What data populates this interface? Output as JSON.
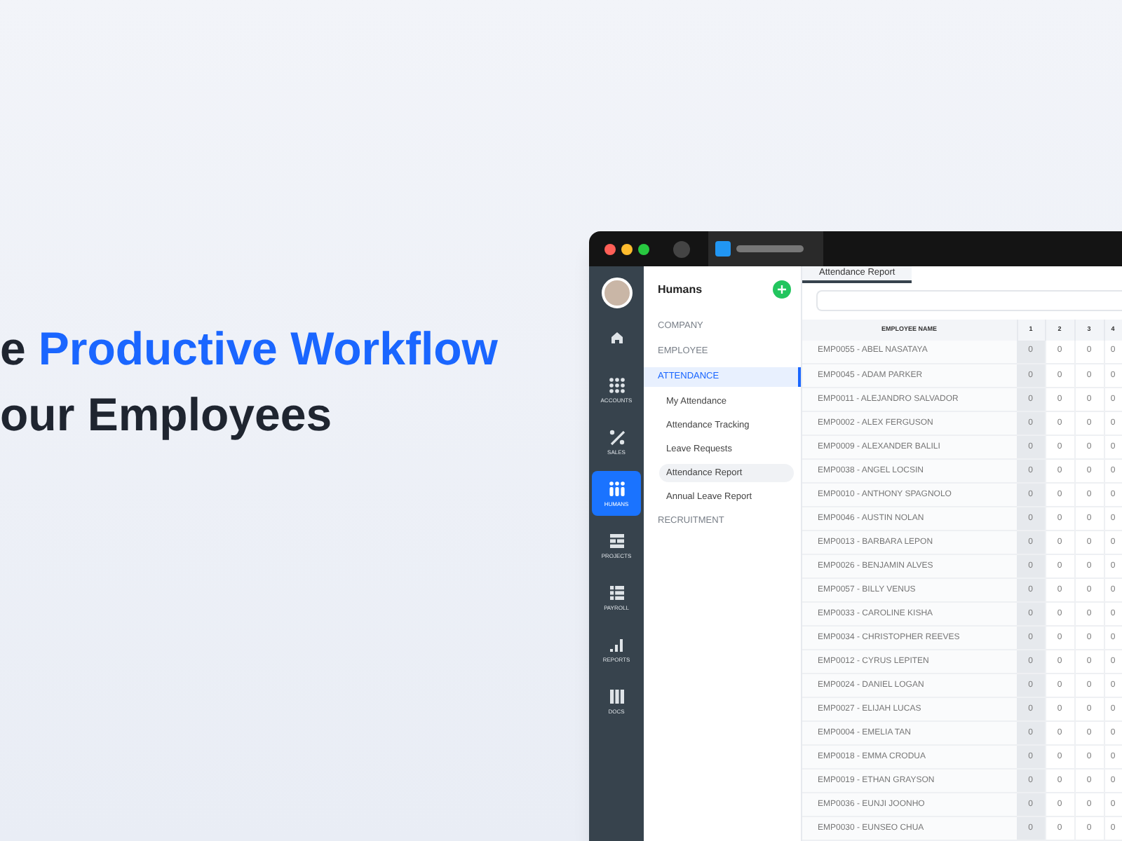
{
  "headline": {
    "lines": [
      [
        {
          "text": "e",
          "accent": false
        },
        {
          "text": "Productive Workflow",
          "accent": true
        }
      ],
      [
        {
          "text": "our Employees",
          "accent": false
        }
      ]
    ]
  },
  "app": {
    "rail": [
      {
        "kind": "avatar",
        "selected": false
      },
      {
        "kind": "home",
        "selected": false
      },
      {
        "kind": "grid",
        "label": "ACCOUNTS",
        "selected": false
      },
      {
        "kind": "percent",
        "label": "SALES",
        "selected": false
      },
      {
        "kind": "people",
        "label": "HUMANS",
        "selected": true
      },
      {
        "kind": "projects",
        "label": "PROJECTS",
        "selected": false
      },
      {
        "kind": "list",
        "label": "PAYROLL",
        "selected": false
      },
      {
        "kind": "bars",
        "label": "REPORTS",
        "selected": false
      },
      {
        "kind": "docs",
        "label": "DOCS",
        "selected": false
      }
    ],
    "module": {
      "title": "Humans",
      "menu": [
        {
          "label": "COMPANY",
          "selected": false
        },
        {
          "label": "EMPLOYEE",
          "selected": false
        },
        {
          "label": "ATTENDANCE",
          "selected": true,
          "children": [
            {
              "label": "My Attendance",
              "selected": false
            },
            {
              "label": "Attendance Tracking",
              "selected": false
            },
            {
              "label": "Leave Requests",
              "selected": false
            },
            {
              "label": "Attendance Report",
              "selected": true
            },
            {
              "label": "Annual Leave Report",
              "selected": false
            }
          ]
        },
        {
          "label": "RECRUITMENT",
          "selected": false
        }
      ]
    },
    "tab": {
      "label": "Attendance Report",
      "selected": true
    },
    "table": {
      "columns": [
        "EMPLOYEE NAME",
        "1",
        "2",
        "3",
        "4"
      ],
      "rows": [
        {
          "cells": [
            "EMP0055 - ABEL NASATAYA",
            "0",
            "0",
            "0",
            "0"
          ]
        },
        {
          "cells": [
            "EMP0045 - ADAM PARKER",
            "0",
            "0",
            "0",
            "0"
          ]
        },
        {
          "cells": [
            "EMP0011 - ALEJANDRO SALVADOR",
            "0",
            "0",
            "0",
            "0"
          ]
        },
        {
          "cells": [
            "EMP0002 - ALEX FERGUSON",
            "0",
            "0",
            "0",
            "0"
          ]
        },
        {
          "cells": [
            "EMP0009 - ALEXANDER BALILI",
            "0",
            "0",
            "0",
            "0"
          ]
        },
        {
          "cells": [
            "EMP0038 - ANGEL LOCSIN",
            "0",
            "0",
            "0",
            "0"
          ]
        },
        {
          "cells": [
            "EMP0010 - ANTHONY SPAGNOLO",
            "0",
            "0",
            "0",
            "0"
          ]
        },
        {
          "cells": [
            "EMP0046 - AUSTIN NOLAN",
            "0",
            "0",
            "0",
            "0"
          ]
        },
        {
          "cells": [
            "EMP0013 - BARBARA LEPON",
            "0",
            "0",
            "0",
            "0"
          ]
        },
        {
          "cells": [
            "EMP0026 - BENJAMIN ALVES",
            "0",
            "0",
            "0",
            "0"
          ]
        },
        {
          "cells": [
            "EMP0057 - BILLY VENUS",
            "0",
            "0",
            "0",
            "0"
          ]
        },
        {
          "cells": [
            "EMP0033 - CAROLINE KISHA",
            "0",
            "0",
            "0",
            "0"
          ]
        },
        {
          "cells": [
            "EMP0034 - CHRISTOPHER REEVES",
            "0",
            "0",
            "0",
            "0"
          ]
        },
        {
          "cells": [
            "EMP0012 - CYRUS LEPITEN",
            "0",
            "0",
            "0",
            "0"
          ]
        },
        {
          "cells": [
            "EMP0024 - DANIEL LOGAN",
            "0",
            "0",
            "0",
            "0"
          ]
        },
        {
          "cells": [
            "EMP0027 - ELIJAH LUCAS",
            "0",
            "0",
            "0",
            "0"
          ]
        },
        {
          "cells": [
            "EMP0004 - EMELIA TAN",
            "0",
            "0",
            "0",
            "0"
          ]
        },
        {
          "cells": [
            "EMP0018 - EMMA CRODUA",
            "0",
            "0",
            "0",
            "0"
          ]
        },
        {
          "cells": [
            "EMP0019 - ETHAN GRAYSON",
            "0",
            "0",
            "0",
            "0"
          ]
        },
        {
          "cells": [
            "EMP0036 - EUNJI JOONHO",
            "0",
            "0",
            "0",
            "0"
          ]
        },
        {
          "cells": [
            "EMP0030 - EUNSEO CHUA",
            "0",
            "0",
            "0",
            "0"
          ]
        }
      ]
    }
  }
}
